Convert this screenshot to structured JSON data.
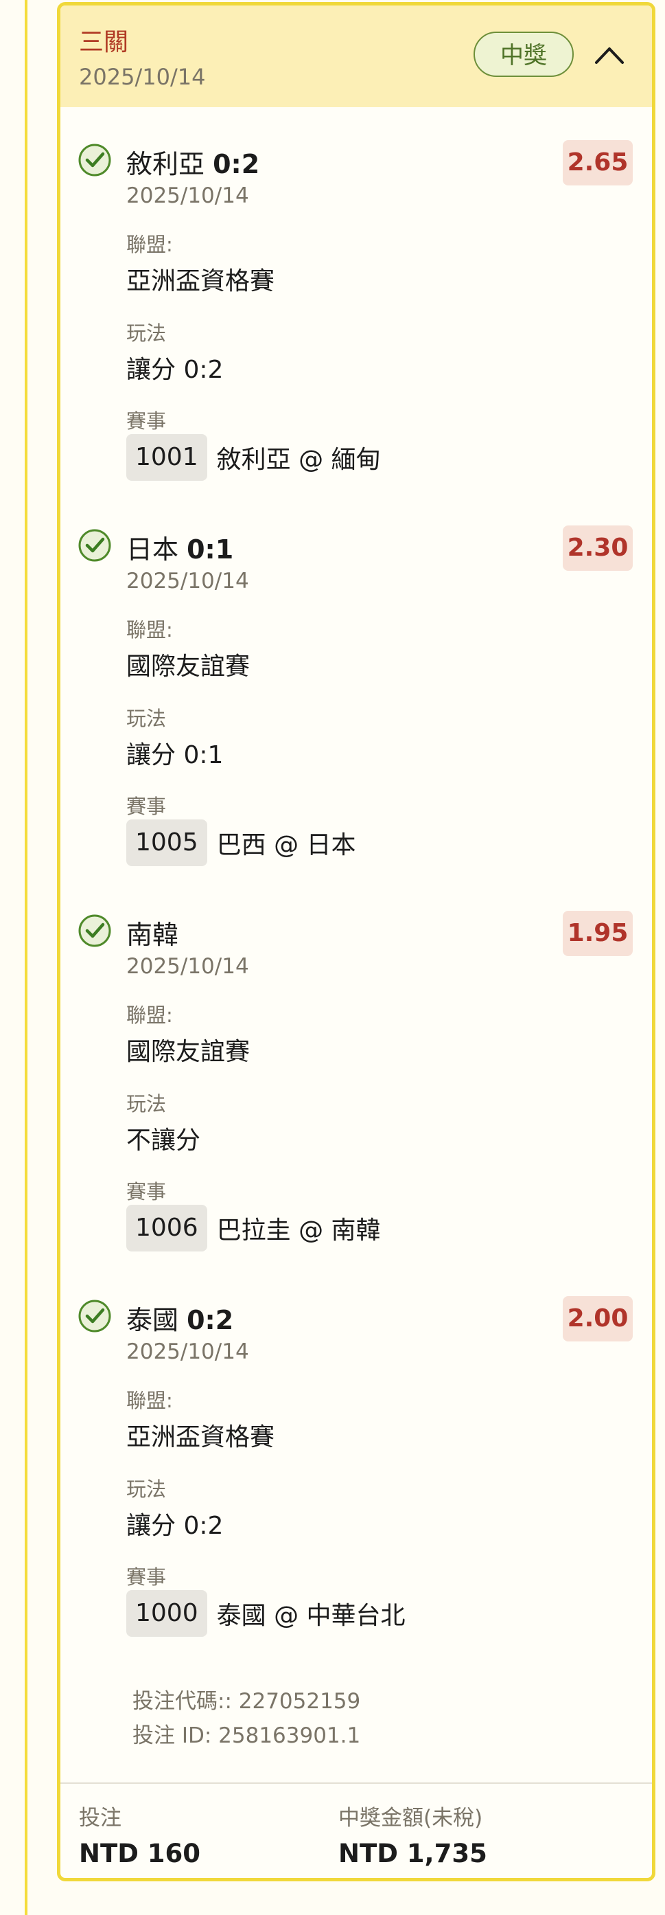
{
  "bet": {
    "type": "三關",
    "date": "2025/10/14",
    "status": "中獎",
    "code_line": "投注代碼:: 227052159",
    "id_line": "投注 ID: 258163901.1"
  },
  "legs": [
    {
      "selection": "敘利亞",
      "handicap": "0:2",
      "odds": "2.65",
      "date": "2025/10/14",
      "league_label": "聯盟:",
      "league": "亞洲盃資格賽",
      "market_label": "玩法",
      "market": "讓分 0:2",
      "match_label": "賽事",
      "match_code": "1001",
      "match": "敘利亞 @ 緬甸"
    },
    {
      "selection": "日本",
      "handicap": "0:1",
      "odds": "2.30",
      "date": "2025/10/14",
      "league_label": "聯盟:",
      "league": "國際友誼賽",
      "market_label": "玩法",
      "market": "讓分 0:1",
      "match_label": "賽事",
      "match_code": "1005",
      "match": "巴西 @ 日本"
    },
    {
      "selection": "南韓",
      "handicap": "",
      "odds": "1.95",
      "date": "2025/10/14",
      "league_label": "聯盟:",
      "league": "國際友誼賽",
      "market_label": "玩法",
      "market": "不讓分",
      "match_label": "賽事",
      "match_code": "1006",
      "match": "巴拉圭 @ 南韓"
    },
    {
      "selection": "泰國",
      "handicap": "0:2",
      "odds": "2.00",
      "date": "2025/10/14",
      "league_label": "聯盟:",
      "league": "亞洲盃資格賽",
      "market_label": "玩法",
      "market": "讓分 0:2",
      "match_label": "賽事",
      "match_code": "1000",
      "match": "泰國 @ 中華台北"
    }
  ],
  "footer": {
    "stake_label": "投注",
    "stake_value": "NTD 160",
    "payout_label": "中獎金額(未稅)",
    "payout_value": "NTD 1,735"
  },
  "icons": {
    "check": "check-circle-icon",
    "collapse": "chevron-up-icon"
  },
  "colors": {
    "header_bg": "#fcefb6",
    "card_border": "#f0d83a",
    "win_green": "#4f7328",
    "odds_red": "#b0342a",
    "type_red": "#b03a24"
  }
}
